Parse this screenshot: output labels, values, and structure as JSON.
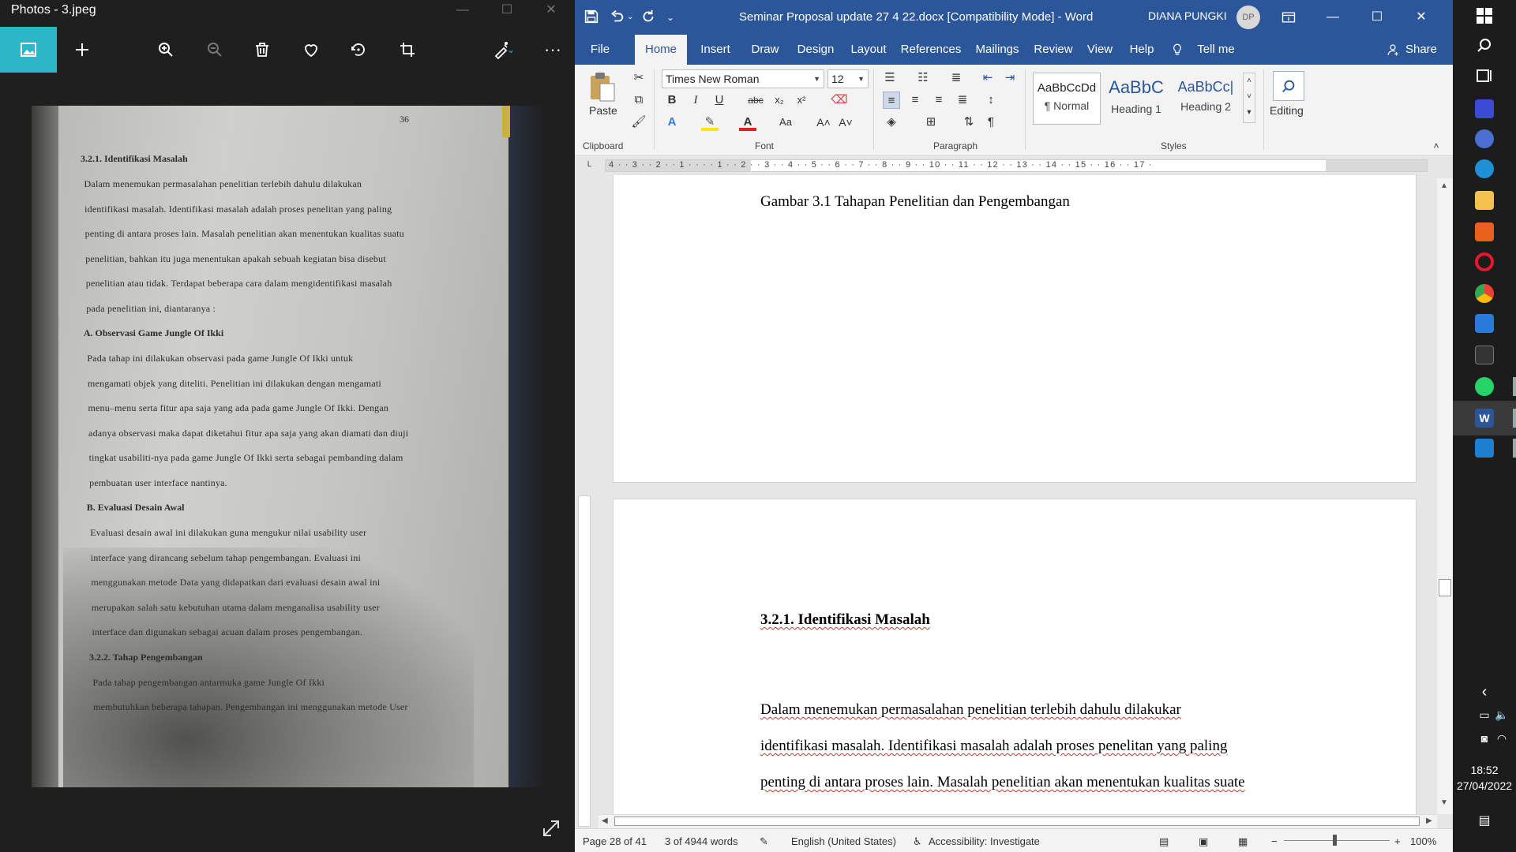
{
  "photos": {
    "title": "Photos - 3.jpeg",
    "toolbar": [
      "image-icon",
      "add-icon",
      "zoom-in-icon",
      "zoom-out-icon",
      "delete-icon",
      "favorite-icon",
      "rotate-icon",
      "crop-icon",
      "edit-icon",
      "more-icon"
    ],
    "photo": {
      "page_number": "36",
      "lines": [
        {
          "t": "3.2.1.   Identifikasi Masalah",
          "b": true
        },
        {
          "t": "Dalam menemukan permasalahan penelitian terlebih dahulu dilakukan"
        },
        {
          "t": "identifikasi masalah. Identifikasi masalah adalah proses penelitan yang paling"
        },
        {
          "t": "penting di antara proses lain. Masalah penelitian akan menentukan kualitas suatu"
        },
        {
          "t": "penelitian, bahkan itu juga menentukan apakah sebuah kegiatan bisa disebut"
        },
        {
          "t": "penelitian atau tidak. Terdapat beberapa cara dalam mengidentifikasi masalah"
        },
        {
          "t": "pada penelitian ini, diantaranya :"
        },
        {
          "t": "A.   Observasi Game Jungle Of Ikki",
          "b": true
        },
        {
          "t": "Pada tahap ini dilakukan observasi pada game Jungle Of Ikki untuk"
        },
        {
          "t": "mengamati objek yang diteliti. Penelitian ini dilakukan dengan mengamati"
        },
        {
          "t": "menu–menu serta fitur apa saja yang ada pada game Jungle Of Ikki. Dengan"
        },
        {
          "t": "adanya observasi maka dapat diketahui fitur apa saja yang akan diamati dan diuji"
        },
        {
          "t": "tingkat usabiliti-nya pada game Jungle Of Ikki serta sebagai pembanding dalam"
        },
        {
          "t": "pembuatan user interface nantinya."
        },
        {
          "t": "B.   Evaluasi Desain Awal",
          "b": true
        },
        {
          "t": "Evaluasi desain awal ini dilakukan guna mengukur nilai usability user"
        },
        {
          "t": "interface yang dirancang sebelum tahap pengembangan. Evaluasi ini"
        },
        {
          "t": "menggunakan metode Data yang didapatkan dari evaluasi desain awal ini"
        },
        {
          "t": "merupakan salah satu kebutuhan utama dalam menganalisa usability user"
        },
        {
          "t": "interface dan digunakan sebagai acuan dalam proses pengembangan."
        },
        {
          "t": "3.2.2.   Tahap Pengembangan",
          "b": true
        },
        {
          "t": "Pada tahap pengembangan antarmuka game Jungle Of Ikki"
        },
        {
          "t": "membutuhkan beberapa tahapan. Pengembangan ini menggunakan metode User"
        }
      ]
    }
  },
  "word": {
    "title": "Seminar Proposal update 27 4 22.docx [Compatibility Mode]  -  Word",
    "user": "DIANA PUNGKI",
    "avatar": "DP",
    "tabs": [
      "File",
      "Home",
      "Insert",
      "Draw",
      "Design",
      "Layout",
      "References",
      "Mailings",
      "Review",
      "View",
      "Help",
      "Tell me",
      "Share"
    ],
    "active_tab": "Home",
    "ribbon": {
      "paste": "Paste",
      "font_name": "Times New Roman",
      "font_size": "12",
      "styles": [
        {
          "sample": "AaBbCcDd",
          "name": "¶ Normal"
        },
        {
          "sample": "AaBbC",
          "name": "Heading 1"
        },
        {
          "sample": "AaBbCc|",
          "name": "Heading 2"
        }
      ],
      "editing": "Editing",
      "groups": [
        "Clipboard",
        "Font",
        "Paragraph",
        "Styles"
      ]
    },
    "ruler": "4 · · 3 · · 2 · · 1 · · · · 1 · · 2 · · 3 · · 4 · · 5 · · 6 · · 7 · · 8 · · 9 · · 10 · · 11 · · 12 · · 13 · · 14 · · 15 · · 16 · · 17 ·",
    "document": {
      "caption": "Gambar 3.1 Tahapan Penelitian dan Pengembangan",
      "heading": "3.2.1. Identifikasi Masalah",
      "para_lines": [
        "Dalam menemukan permasalahan penelitian terlebih dahulu dilakukar",
        "identifikasi masalah. Identifikasi masalah adalah proses penelitan yang paling",
        "penting di antara proses lain. Masalah penelitian akan menentukan kualitas suate"
      ]
    },
    "status": {
      "page": "Page 28 of 41",
      "words": "3 of 4944 words",
      "language": "English (United States)",
      "accessibility": "Accessibility: Investigate",
      "zoom": "100%"
    }
  },
  "taskbar": {
    "time": "18:52",
    "date": "27/04/2022"
  }
}
